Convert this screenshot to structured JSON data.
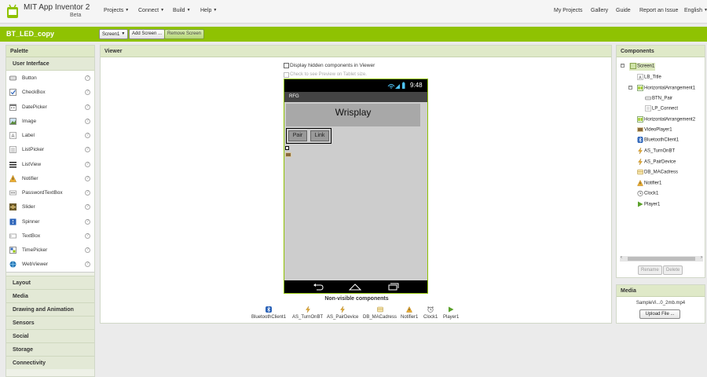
{
  "app": {
    "title": "MIT App Inventor 2",
    "subtitle": "Beta",
    "accent_color": "#8fc202"
  },
  "topnav": {
    "left": [
      {
        "label": "Projects",
        "icon": "caret-down-icon"
      },
      {
        "label": "Connect",
        "icon": "caret-down-icon"
      },
      {
        "label": "Build",
        "icon": "caret-down-icon"
      },
      {
        "label": "Help",
        "icon": "caret-down-icon"
      }
    ],
    "right": [
      {
        "label": "My Projects"
      },
      {
        "label": "Gallery"
      },
      {
        "label": "Guide"
      },
      {
        "label": "Report an Issue"
      },
      {
        "label": "English",
        "icon": "caret-down-icon"
      }
    ]
  },
  "project": {
    "name": "BT_LED_copy",
    "screen_select": "Screen1",
    "add_screen_label": "Add Screen ...",
    "remove_screen_label": "Remove Screen"
  },
  "palette": {
    "title": "Palette",
    "section": "User Interface",
    "items": [
      {
        "label": "Button",
        "icon": "button-icon"
      },
      {
        "label": "CheckBox",
        "icon": "checkbox-icon"
      },
      {
        "label": "DatePicker",
        "icon": "datepicker-icon"
      },
      {
        "label": "Image",
        "icon": "image-icon"
      },
      {
        "label": "Label",
        "icon": "label-icon"
      },
      {
        "label": "ListPicker",
        "icon": "listpicker-icon"
      },
      {
        "label": "ListView",
        "icon": "listview-icon"
      },
      {
        "label": "Notifier",
        "icon": "notifier-icon"
      },
      {
        "label": "PasswordTextBox",
        "icon": "password-icon"
      },
      {
        "label": "Slider",
        "icon": "slider-icon"
      },
      {
        "label": "Spinner",
        "icon": "spinner-icon"
      },
      {
        "label": "TextBox",
        "icon": "textbox-icon"
      },
      {
        "label": "TimePicker",
        "icon": "timepicker-icon"
      },
      {
        "label": "WebViewer",
        "icon": "webviewer-icon"
      }
    ],
    "help_glyph": "?",
    "categories": [
      "Layout",
      "Media",
      "Drawing and Animation",
      "Sensors",
      "Social",
      "Storage",
      "Connectivity"
    ]
  },
  "viewer": {
    "title": "Viewer",
    "display_hidden_label": "Display hidden components in Viewer",
    "tablet_label": "Check to see Preview on Tablet size.",
    "phone": {
      "clock": "9:48",
      "screen_title": "RFG",
      "title_label": "Wrisplay",
      "pair_button": "Pair",
      "link_button": "Link"
    },
    "nonvisible_title": "Non-visible components",
    "nonvisible": [
      {
        "label": "BluetoothClient1",
        "icon": "bluetooth-icon"
      },
      {
        "label": "AS_TurnOnBT",
        "icon": "activity-starter-icon"
      },
      {
        "label": "AS_PairDevice",
        "icon": "activity-starter-icon"
      },
      {
        "label": "DB_MACadress",
        "icon": "tinydb-icon"
      },
      {
        "label": "Notifier1",
        "icon": "notifier-icon"
      },
      {
        "label": "Clock1",
        "icon": "clock-icon"
      },
      {
        "label": "Player1",
        "icon": "player-icon"
      }
    ]
  },
  "components": {
    "title": "Components",
    "tree": [
      {
        "label": "Screen1",
        "icon": "screen-icon"
      },
      {
        "label": "LB_Title",
        "icon": "label-icon"
      },
      {
        "label": "HorizontalArrangement1",
        "icon": "horizontal-arrangement-icon"
      },
      {
        "label": "BTN_Pair",
        "icon": "button-icon"
      },
      {
        "label": "LP_Connect",
        "icon": "listpicker-icon"
      },
      {
        "label": "HorizontalArrangement2",
        "icon": "horizontal-arrangement-icon"
      },
      {
        "label": "VideoPlayer1",
        "icon": "videoplayer-icon"
      },
      {
        "label": "BluetoothClient1",
        "icon": "bluetooth-icon"
      },
      {
        "label": "AS_TurnOnBT",
        "icon": "activity-starter-icon"
      },
      {
        "label": "AS_PairDevice",
        "icon": "activity-starter-icon"
      },
      {
        "label": "DB_MACadress",
        "icon": "tinydb-icon"
      },
      {
        "label": "Notifier1",
        "icon": "notifier-icon"
      },
      {
        "label": "Clock1",
        "icon": "clock-icon"
      },
      {
        "label": "Player1",
        "icon": "player-icon"
      }
    ],
    "rename_label": "Rename",
    "delete_label": "Delete"
  },
  "media": {
    "title": "Media",
    "file": "SampleVi...0_2mb.mp4",
    "upload_label": "Upload File ..."
  }
}
